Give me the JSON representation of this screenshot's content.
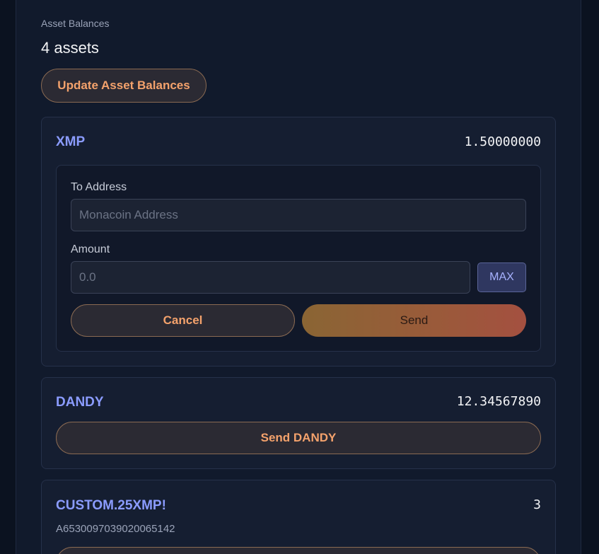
{
  "balances": {
    "section_label": "Asset Balances",
    "asset_count": "4 assets",
    "update_label": "Update Asset Balances"
  },
  "assets": [
    {
      "name": "XMP",
      "balance": "1.50000000",
      "form": {
        "to_address_label": "To Address",
        "to_address_placeholder": "Monacoin Address",
        "to_address_value": "",
        "amount_label": "Amount",
        "amount_placeholder": "0.0",
        "amount_value": "",
        "max_label": "MAX",
        "cancel_label": "Cancel",
        "send_label": "Send"
      }
    },
    {
      "name": "DANDY",
      "balance": "12.34567890",
      "send_label": "Send DANDY"
    },
    {
      "name": "CUSTOM.25XMP!",
      "balance": "3",
      "asset_id": "A6530097039020065142"
    }
  ],
  "colors": {
    "accent_orange": "#f4a26c",
    "asset_name": "#8b9cff",
    "background": "#0b1220"
  }
}
